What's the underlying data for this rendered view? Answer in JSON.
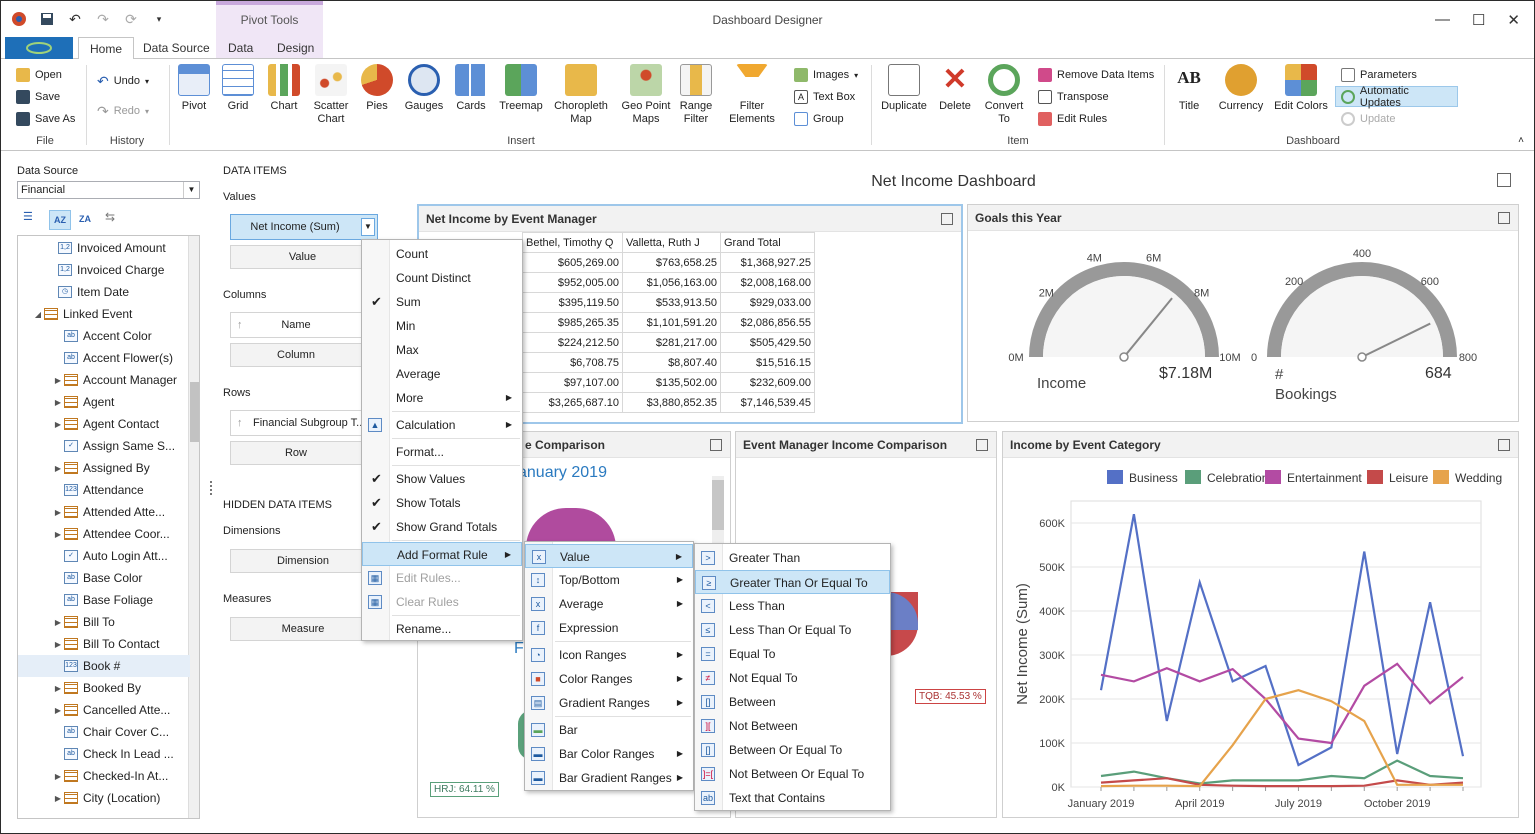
{
  "window": {
    "title": "Dashboard Designer",
    "context_tab": "Pivot Tools"
  },
  "tabs": [
    "Home",
    "Data Source",
    "Data",
    "Design"
  ],
  "ribbon": {
    "file": {
      "label": "File",
      "open": "Open",
      "save": "Save",
      "save_as": "Save As"
    },
    "history": {
      "label": "History",
      "undo": "Undo",
      "redo": "Redo"
    },
    "insert": {
      "label": "Insert",
      "items": [
        "Pivot",
        "Grid",
        "Chart",
        "Scatter Chart",
        "Pies",
        "Gauges",
        "Cards",
        "Treemap",
        "Choropleth Map",
        "Geo Point Maps",
        "Range Filter",
        "Filter Elements"
      ],
      "images": "Images",
      "text_box": "Text Box",
      "group": "Group"
    },
    "item": {
      "label": "Item",
      "duplicate": "Duplicate",
      "delete": "Delete",
      "convert": "Convert To",
      "remove_data_items": "Remove Data Items",
      "transpose": "Transpose",
      "edit_rules": "Edit Rules"
    },
    "dashboard": {
      "label": "Dashboard",
      "title": "Title",
      "currency": "Currency",
      "edit_colors": "Edit Colors",
      "parameters": "Parameters",
      "automatic_updates": "Automatic Updates",
      "update": "Update"
    }
  },
  "datasource": {
    "label": "Data Source",
    "value": "Financial",
    "fields": [
      {
        "label": "Invoiced Amount",
        "icon": "1,2"
      },
      {
        "label": "Invoiced Charge",
        "icon": "1,2"
      },
      {
        "label": "Item Date",
        "icon": "clk"
      },
      {
        "label": "Linked Event",
        "icon": "tbl"
      },
      {
        "label": "Accent Color",
        "icon": "ab"
      },
      {
        "label": "Accent Flower(s)",
        "icon": "ab"
      },
      {
        "label": "Account Manager",
        "icon": "tbl"
      },
      {
        "label": "Agent",
        "icon": "tbl"
      },
      {
        "label": "Agent Contact",
        "icon": "tbl"
      },
      {
        "label": "Assign Same S...",
        "icon": "chk"
      },
      {
        "label": "Assigned By",
        "icon": "tbl"
      },
      {
        "label": "Attendance",
        "icon": "123"
      },
      {
        "label": "Attended Atte...",
        "icon": "tbl"
      },
      {
        "label": "Attendee Coor...",
        "icon": "tbl"
      },
      {
        "label": "Auto Login Att...",
        "icon": "chk"
      },
      {
        "label": "Base Color",
        "icon": "ab"
      },
      {
        "label": "Base Foliage",
        "icon": "ab"
      },
      {
        "label": "Bill To",
        "icon": "tbl"
      },
      {
        "label": "Bill To Contact",
        "icon": "tbl"
      },
      {
        "label": "Book #",
        "icon": "123"
      },
      {
        "label": "Booked By",
        "icon": "tbl"
      },
      {
        "label": "Cancelled Atte...",
        "icon": "tbl"
      },
      {
        "label": "Chair Cover C...",
        "icon": "ab"
      },
      {
        "label": "Check In Lead ...",
        "icon": "ab"
      },
      {
        "label": "Checked-In At...",
        "icon": "tbl"
      },
      {
        "label": "City (Location)",
        "icon": "tbl"
      }
    ]
  },
  "data_items": {
    "title": "DATA ITEMS",
    "values": "Values",
    "net_income": "Net Income (Sum)",
    "value_btn": "Value",
    "columns": "Columns",
    "name": "Name",
    "column_btn": "Column",
    "rows": "Rows",
    "financial_subgroup": "Financial Subgroup T...",
    "row_btn": "Row",
    "hidden": "HIDDEN DATA ITEMS",
    "dimensions": "Dimensions",
    "dimension_btn": "Dimension",
    "measures": "Measures",
    "measure_btn": "Measure"
  },
  "dashboard": {
    "title": "Net Income Dashboard",
    "pivot": {
      "title": "Net Income by Event Manager",
      "headers": [
        "Bethel, Timothy Q",
        "Valletta, Ruth J",
        "Grand Total"
      ],
      "rows": [
        [
          "$605,269.00",
          "$763,658.25",
          "$1,368,927.25"
        ],
        [
          "$952,005.00",
          "$1,056,163.00",
          "$2,008,168.00"
        ],
        [
          "$395,119.50",
          "$533,913.50",
          "$929,033.00"
        ],
        [
          "$985,265.35",
          "$1,101,591.20",
          "$2,086,856.55"
        ],
        [
          "$224,212.50",
          "$281,217.00",
          "$505,429.50"
        ],
        [
          "$6,708.75",
          "$8,807.40",
          "$15,516.15"
        ],
        [
          "$97,107.00",
          "$135,502.00",
          "$232,609.00"
        ],
        [
          "$3,265,687.10",
          "$3,880,852.35",
          "$7,146,539.45"
        ]
      ]
    },
    "goals": {
      "title": "Goals this Year",
      "income": {
        "label": "Income",
        "value": "$7.18M",
        "ticks": [
          "0M",
          "2M",
          "4M",
          "6M",
          "8M",
          "10M"
        ],
        "fraction": 0.718
      },
      "bookings": {
        "label": "# Bookings",
        "value": "684",
        "ticks": [
          "0",
          "200",
          "400",
          "600",
          "800"
        ],
        "fraction": 0.855
      }
    },
    "comparison": {
      "title": "e Comparison",
      "subtitle": "anuary 2019",
      "label_f": "F",
      "tag": "HRJ: 64.11 %"
    },
    "manager": {
      "title": "Event Manager Income Comparison",
      "tag": "TQB: 45.53 %"
    },
    "category": {
      "title": "Income by Event Category"
    }
  },
  "chart_data": {
    "type": "line",
    "title": "Income by Event Category",
    "xlabel": "",
    "ylabel": "Net Income (Sum)",
    "x": [
      "January 2019",
      "February 2019",
      "March 2019",
      "April 2019",
      "May 2019",
      "June 2019",
      "July 2019",
      "August 2019",
      "September 2019",
      "October 2019",
      "November 2019",
      "December 2019"
    ],
    "xticks": [
      "January 2019",
      "April 2019",
      "July 2019",
      "October 2019"
    ],
    "yticks": [
      "0K",
      "100K",
      "200K",
      "300K",
      "400K",
      "500K",
      "600K"
    ],
    "ylim": [
      0,
      650000
    ],
    "legend": "top",
    "grid": true,
    "series": [
      {
        "name": "Business",
        "color": "#5470c6",
        "values": [
          220000,
          620000,
          150000,
          465000,
          240000,
          275000,
          50000,
          90000,
          535000,
          75000,
          420000,
          70000
        ]
      },
      {
        "name": "Celebration",
        "color": "#5a9e7a",
        "values": [
          25000,
          35000,
          20000,
          8000,
          15000,
          15000,
          15000,
          25000,
          20000,
          60000,
          25000,
          20000
        ]
      },
      {
        "name": "Entertainment",
        "color": "#b34ba3",
        "values": [
          255000,
          240000,
          270000,
          240000,
          268000,
          200000,
          110000,
          100000,
          230000,
          280000,
          190000,
          250000
        ]
      },
      {
        "name": "Leisure",
        "color": "#c44a4a",
        "values": [
          10000,
          15000,
          20000,
          5000,
          3000,
          2000,
          2000,
          2000,
          3000,
          15000,
          5000,
          10000
        ]
      },
      {
        "name": "Wedding",
        "color": "#e6a34c",
        "values": [
          2000,
          3000,
          3000,
          2000,
          95000,
          200000,
          220000,
          195000,
          150000,
          5000,
          5000,
          5000
        ]
      }
    ]
  },
  "menu_main": {
    "items": [
      "Count",
      "Count Distinct",
      "Sum",
      "Min",
      "Max",
      "Average",
      "More",
      "Calculation",
      "Format...",
      "Show Values",
      "Show Totals",
      "Show Grand Totals",
      "Add Format Rule",
      "Edit Rules...",
      "Clear Rules",
      "Rename..."
    ]
  },
  "menu_format": {
    "items": [
      "Value",
      "Top/Bottom",
      "Average",
      "Expression",
      "Icon Ranges",
      "Color Ranges",
      "Gradient Ranges",
      "Bar",
      "Bar Color Ranges",
      "Bar Gradient Ranges"
    ]
  },
  "menu_value": {
    "items": [
      "Greater Than",
      "Greater Than Or Equal To",
      "Less Than",
      "Less Than Or Equal To",
      "Equal To",
      "Not Equal To",
      "Between",
      "Not Between",
      "Between Or Equal To",
      "Not Between Or Equal To",
      "Text that Contains"
    ]
  }
}
